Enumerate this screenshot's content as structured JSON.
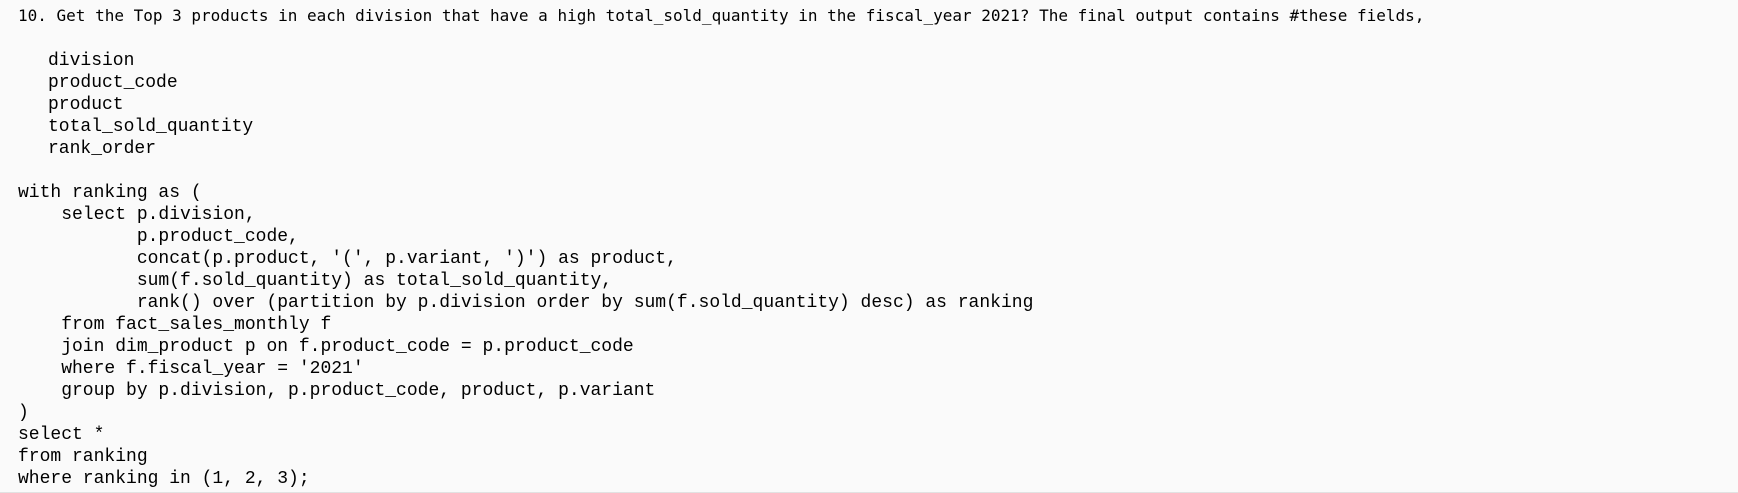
{
  "question": {
    "text": "10. Get the Top 3 products in each division that have a high total_sold_quantity in the fiscal_year 2021? The final output contains #these fields,"
  },
  "fields": [
    "division",
    "product_code",
    "product",
    "total_sold_quantity",
    "rank_order"
  ],
  "query": {
    "lines": [
      "with ranking as (",
      "    select p.division,",
      "           p.product_code,",
      "           concat(p.product, '(', p.variant, ')') as product,",
      "           sum(f.sold_quantity) as total_sold_quantity,",
      "           rank() over (partition by p.division order by sum(f.sold_quantity) desc) as ranking",
      "    from fact_sales_monthly f",
      "    join dim_product p on f.product_code = p.product_code",
      "    where f.fiscal_year = '2021'",
      "    group by p.division, p.product_code, product, p.variant",
      ")",
      "select *",
      "from ranking",
      "where ranking in (1, 2, 3);"
    ]
  }
}
